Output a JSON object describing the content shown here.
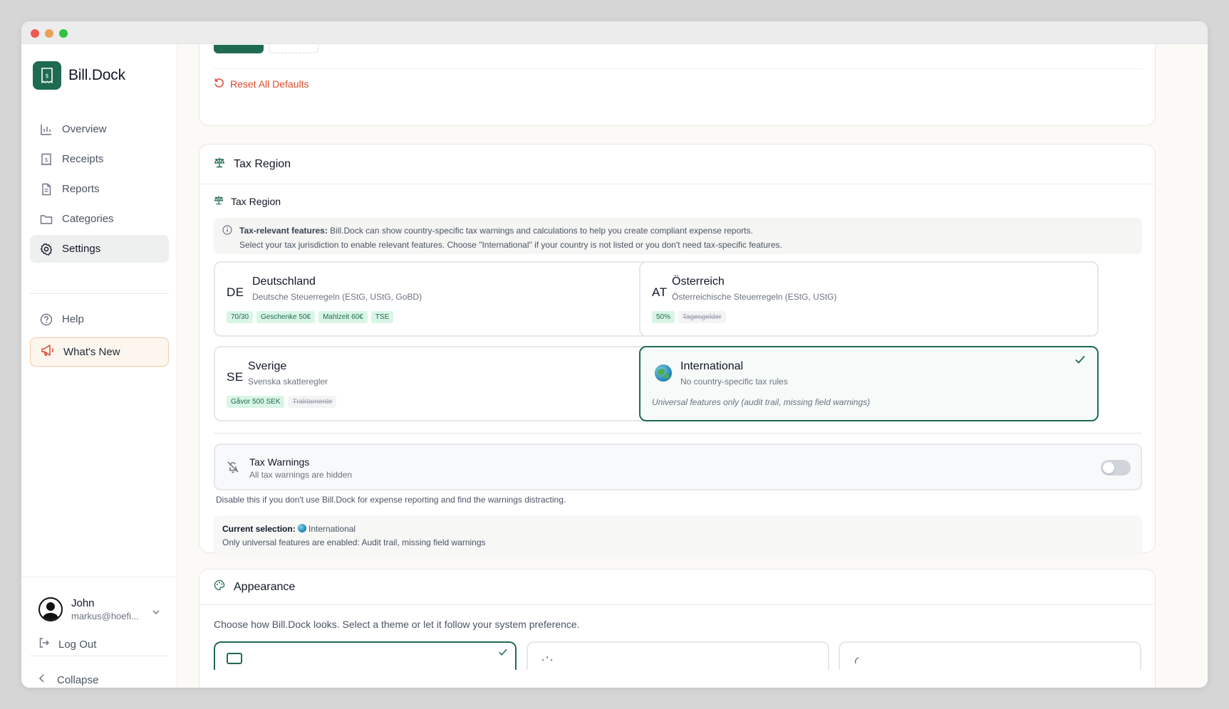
{
  "app": {
    "name": "Bill.Dock"
  },
  "sidebar": {
    "items": [
      {
        "label": "Overview",
        "icon": "bar-chart-icon"
      },
      {
        "label": "Receipts",
        "icon": "receipt-icon"
      },
      {
        "label": "Reports",
        "icon": "file-icon"
      },
      {
        "label": "Categories",
        "icon": "folder-icon"
      },
      {
        "label": "Settings",
        "icon": "gear-icon",
        "active": true
      }
    ],
    "secondary": [
      {
        "label": "Help",
        "icon": "help-icon"
      },
      {
        "label": "What's New",
        "icon": "megaphone-icon"
      }
    ],
    "user": {
      "name": "John",
      "email": "markus@hoefi..."
    },
    "logout_label": "Log Out",
    "collapse_label": "Collapse"
  },
  "defaults": {
    "reset_label": "Reset All Defaults"
  },
  "tax_region": {
    "card_title": "Tax Region",
    "section_title": "Tax Region",
    "info_bold": "Tax-relevant features:",
    "info_line1": " Bill.Dock can show country-specific tax warnings and calculations to help you create compliant expense reports.",
    "info_line2": "Select your tax jurisdiction to enable relevant features. Choose \"International\" if your country is not listed or you don't need tax-specific features.",
    "regions": [
      {
        "code": "DE",
        "name": "Deutschland",
        "desc": "Deutsche Steuerregeln (EStG, UStG, GoBD)",
        "tags": [
          "70/30",
          "Geschenke 50€",
          "Mahlzeit 60€",
          "TSE"
        ],
        "disabled_tags": []
      },
      {
        "code": "AT",
        "name": "Österreich",
        "desc": "Österreichische Steuerregeln (EStG, UStG)",
        "tags": [
          "50%"
        ],
        "disabled_tags": [
          "Tagesgelder"
        ]
      },
      {
        "code": "SE",
        "name": "Sverige",
        "desc": "Svenska skatteregler",
        "tags": [
          "Gåvor 500 SEK"
        ],
        "disabled_tags": [
          "Traktamente"
        ]
      },
      {
        "code": "",
        "name": "International",
        "desc": "No country-specific tax rules",
        "note": "Universal features only (audit trail, missing field warnings)",
        "selected": true
      }
    ],
    "warnings": {
      "title": "Tax Warnings",
      "status": "All tax warnings are hidden",
      "enabled": false,
      "hint": "Disable this if you don't use Bill.Dock for expense reporting and find the warnings distracting."
    },
    "current": {
      "label": "Current selection:",
      "value": "International",
      "detail": "Only universal features are enabled: Audit trail, missing field warnings"
    }
  },
  "appearance": {
    "title": "Appearance",
    "desc": "Choose how Bill.Dock looks. Select a theme or let it follow your system preference."
  },
  "colors": {
    "brand": "#1f6b52",
    "danger": "#dc4a2c",
    "tag_bg": "#d9f5e6"
  }
}
